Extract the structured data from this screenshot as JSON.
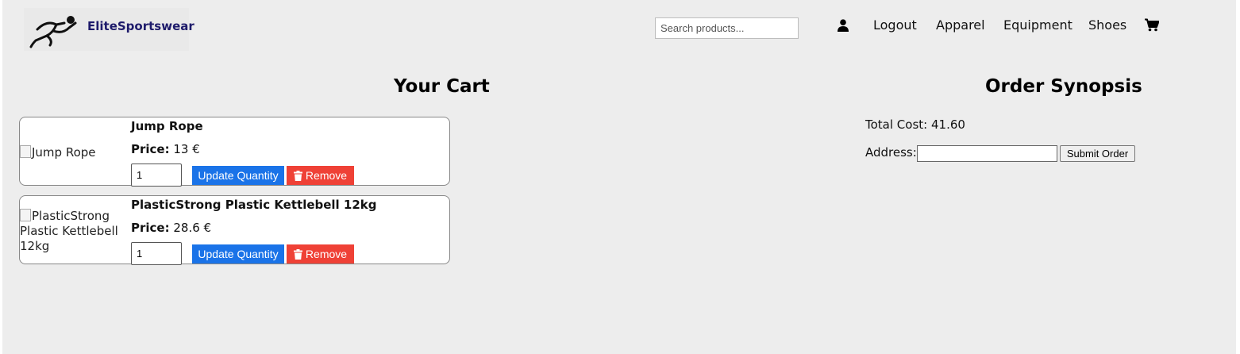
{
  "brand": {
    "name": "EliteSportswear"
  },
  "header": {
    "search_placeholder": "Search products...",
    "nav": [
      "Logout",
      "Apparel",
      "Equipment",
      "Shoes"
    ]
  },
  "cart": {
    "title": "Your Cart",
    "price_label": "Price:",
    "update_label": "Update Quantity",
    "remove_label": "Remove",
    "items": [
      {
        "name": "Jump Rope",
        "image_alt": "Jump Rope",
        "price": "13 €",
        "quantity": "1"
      },
      {
        "name": "PlasticStrong Plastic Kettlebell 12kg",
        "image_alt": "PlasticStrong Plastic Kettlebell 12kg",
        "price": "28.6 €",
        "quantity": "1"
      }
    ]
  },
  "summary": {
    "title": "Order Synopsis",
    "total_label": "Total Cost:",
    "total_value": "41.60",
    "address_label": "Address:",
    "address_value": "",
    "submit_label": "Submit Order"
  },
  "colors": {
    "update_button": "#1a73e8",
    "remove_button": "#ef4136",
    "brand_text": "#1e1b6b",
    "page_background": "#ededed"
  },
  "icons": [
    "runner-logo-icon",
    "user-icon",
    "cart-icon",
    "trash-icon"
  ]
}
